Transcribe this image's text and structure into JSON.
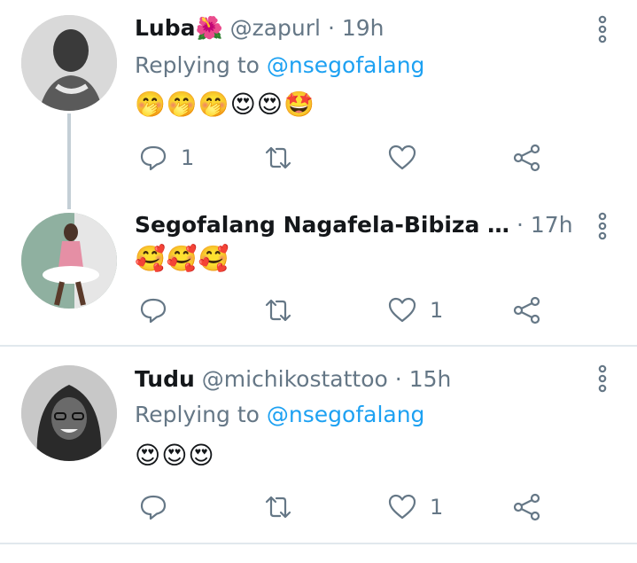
{
  "tweets": [
    {
      "name": "Luba",
      "name_emoji": "🌺",
      "handle": "@zapurl",
      "separator": "·",
      "time": "19h",
      "replying_prefix": "Replying to",
      "replying_to": "@nsegofalang",
      "text": "🤭🤭🤭😍😍🤩",
      "reply_count": "1",
      "retweet_count": "",
      "like_count": ""
    },
    {
      "name": "Segofalang Nagafela-Bibiza …",
      "separator": "·",
      "time": "17h",
      "text": "🥰🥰🥰",
      "reply_count": "",
      "retweet_count": "",
      "like_count": "1"
    },
    {
      "name": "Tudu",
      "handle": "@michikostattoo",
      "separator": "·",
      "time": "15h",
      "replying_prefix": "Replying to",
      "replying_to": "@nsegofalang",
      "text": "😍😍😍",
      "reply_count": "",
      "retweet_count": "",
      "like_count": "1"
    }
  ],
  "icons": {
    "reply": "reply-icon",
    "retweet": "retweet-icon",
    "like": "heart-icon",
    "share": "share-icon",
    "more": "more-vertical-icon"
  },
  "colors": {
    "link": "#1da1f2",
    "secondary_text": "#657786",
    "thread_line": "#c4cfd6"
  }
}
